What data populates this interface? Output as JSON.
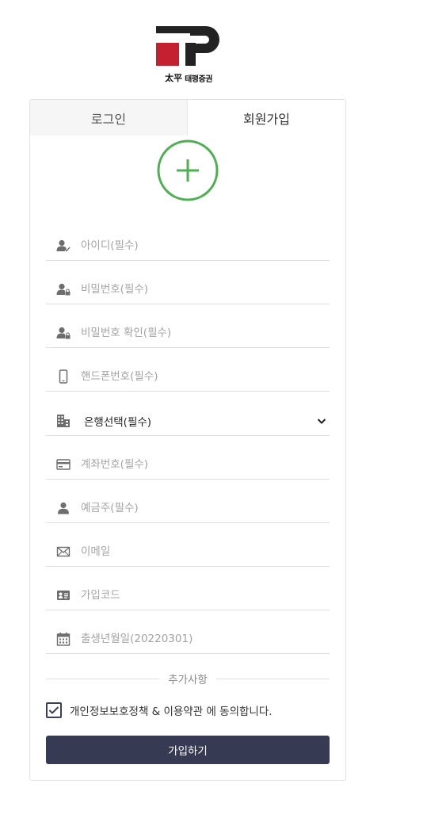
{
  "brand": {
    "logo_hanja": "太平",
    "logo_name": "태평증권",
    "colors": {
      "logo_red": "#c42030",
      "logo_black": "#222222"
    }
  },
  "tabs": [
    {
      "label": "로그인",
      "active": false
    },
    {
      "label": "회원가입",
      "active": true
    }
  ],
  "form": {
    "add_icon": "plus-circle-icon",
    "accent_color": "#4caf50",
    "fields": [
      {
        "icon": "user-check-icon",
        "placeholder": "아이디(필수)",
        "value": ""
      },
      {
        "icon": "user-lock-icon",
        "placeholder": "비밀번호(필수)",
        "value": ""
      },
      {
        "icon": "user-lock-icon",
        "placeholder": "비밀번호 확인(필수)",
        "value": ""
      },
      {
        "icon": "mobile-phone-icon",
        "placeholder": "핸드폰번호(필수)",
        "value": ""
      },
      {
        "icon": "building-icon",
        "select_value": "은행선택(필수)"
      },
      {
        "icon": "credit-card-icon",
        "placeholder": "계좌번호(필수)",
        "value": ""
      },
      {
        "icon": "user-icon",
        "placeholder": "예금주(필수)",
        "value": ""
      },
      {
        "icon": "envelope-icon",
        "placeholder": "이메일",
        "value": ""
      },
      {
        "icon": "id-card-icon",
        "placeholder": "가입코드",
        "value": ""
      },
      {
        "icon": "calendar-icon",
        "placeholder": "출생년월일(20220301)",
        "value": ""
      }
    ],
    "extra_divider": "추가사항",
    "agree": {
      "checked": true,
      "label": "개인정보보호정책 & 이용약관 에 동의합니다."
    },
    "submit_label": "가입하기",
    "submit_color": "#363a53"
  }
}
